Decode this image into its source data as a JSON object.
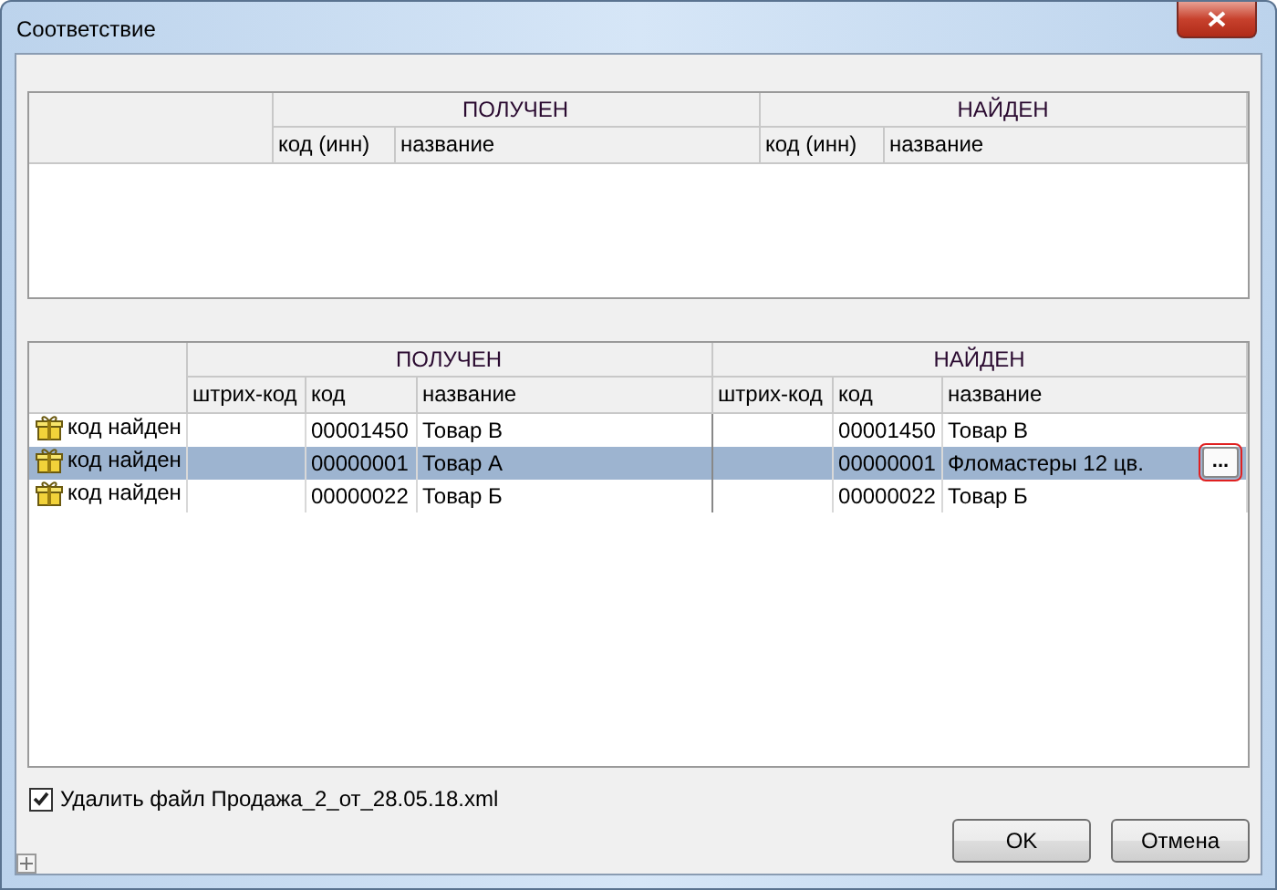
{
  "window": {
    "title": "Соответствие"
  },
  "top_table": {
    "groups": [
      "ПОЛУЧЕН",
      "НАЙДЕН"
    ],
    "columns": [
      "код (инн)",
      "название",
      "код (инн)",
      "название"
    ]
  },
  "bottom_table": {
    "groups": [
      "ПОЛУЧЕН",
      "НАЙДЕН"
    ],
    "columns": [
      "штрих-код",
      "код",
      "название",
      "штрих-код",
      "код",
      "название"
    ],
    "rows": [
      {
        "status": "код найден",
        "selected": false,
        "cells": [
          "",
          "00001450",
          "Товар В",
          "",
          "00001450",
          "Товар В"
        ]
      },
      {
        "status": "код найден",
        "selected": true,
        "cells": [
          "",
          "00000001",
          "Товар А",
          "",
          "00000001",
          "Фломастеры 12 цв."
        ],
        "edit_button": "..."
      },
      {
        "status": "код найден",
        "selected": false,
        "cells": [
          "",
          "00000022",
          "Товар Б",
          "",
          "00000022",
          "Товар Б"
        ]
      }
    ]
  },
  "delete_file": {
    "label": "Удалить файл Продажа_2_от_28.05.18.xml",
    "checked": true
  },
  "buttons": [
    "OK",
    "Отмена"
  ]
}
